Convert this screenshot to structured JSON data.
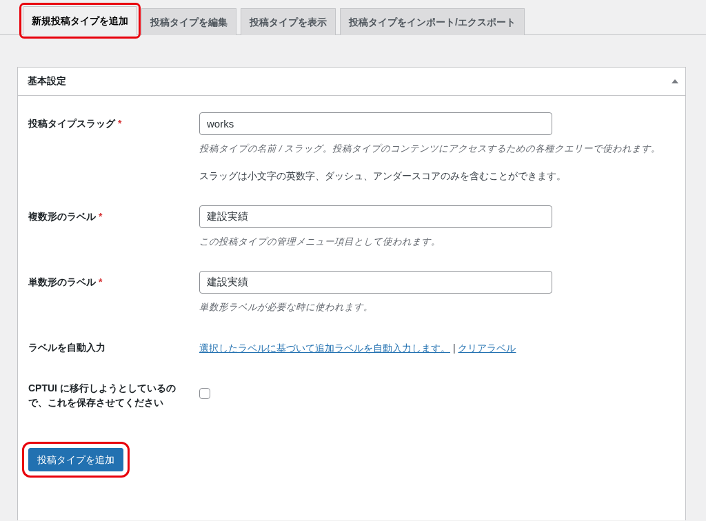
{
  "tabs": [
    {
      "label": "新規投稿タイプを追加",
      "selected": true,
      "highlighted": true
    },
    {
      "label": "投稿タイプを編集",
      "selected": false,
      "highlighted": false
    },
    {
      "label": "投稿タイプを表示",
      "selected": false,
      "highlighted": false
    },
    {
      "label": "投稿タイプをインポート/エクスポート",
      "selected": false,
      "highlighted": false
    }
  ],
  "panel": {
    "title": "基本設定",
    "expanded": true,
    "fields": [
      {
        "kind": "text",
        "label": "投稿タイプスラッグ",
        "required_mark": "*",
        "value": "works",
        "description": "投稿タイプの名前 / スラッグ。投稿タイプのコンテンツにアクセスするための各種クエリーで使われます。",
        "note": "スラッグは小文字の英数字、ダッシュ、アンダースコアのみを含むことができます。"
      },
      {
        "kind": "text",
        "label": "複数形のラベル",
        "required_mark": "*",
        "value": "建設実績",
        "description": "この投稿タイプの管理メニュー項目として使われます。"
      },
      {
        "kind": "text",
        "label": "単数形のラベル",
        "required_mark": "*",
        "value": "建設実績",
        "description": "単数形ラベルが必要な時に使われます。"
      },
      {
        "kind": "links",
        "label": "ラベルを自動入力",
        "links": [
          "選択したラベルに基づいて追加ラベルを自動入力します。",
          "クリアラベル"
        ],
        "separator": "|"
      },
      {
        "kind": "checkbox",
        "label": "CPTUI に移行しようとしているので、これを保存させてください",
        "checked": false
      }
    ],
    "submit": {
      "label": "投稿タイプを追加",
      "highlighted": true
    }
  }
}
